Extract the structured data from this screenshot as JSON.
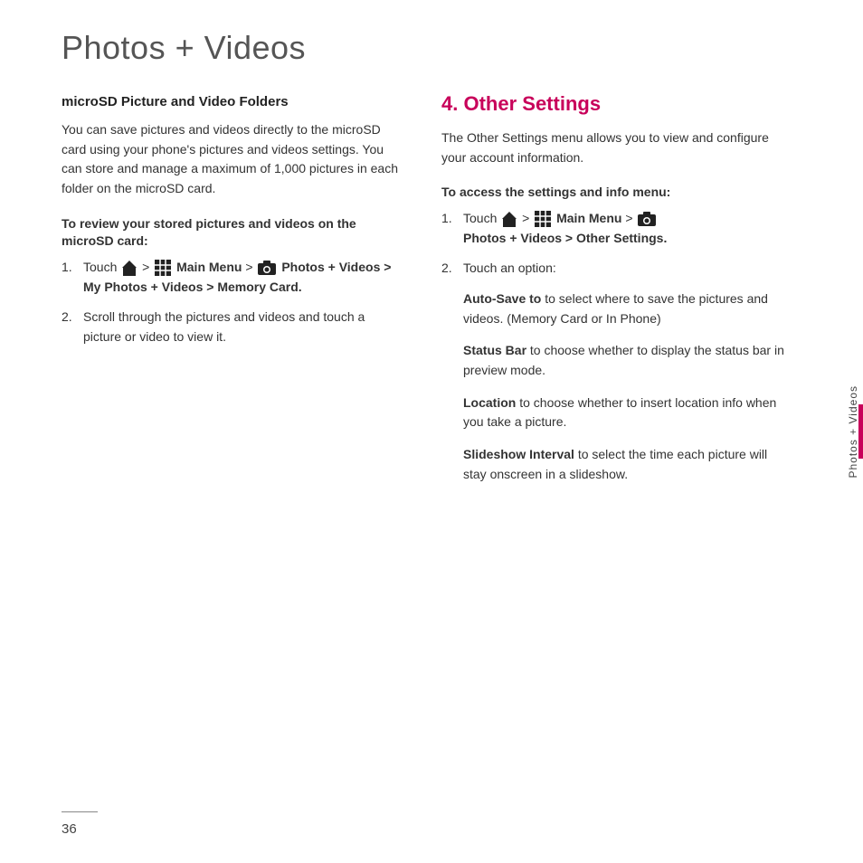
{
  "page": {
    "title": "Photos + Videos",
    "page_number": "36"
  },
  "sidebar": {
    "label": "Photos + Videos"
  },
  "left_column": {
    "heading": "microSD Picture and Video Folders",
    "body": "You can save pictures and videos directly to the microSD card using your phone's pictures and videos settings. You can store and manage a maximum of 1,000 pictures in each folder on the microSD card.",
    "subheading": "To review your stored pictures and videos on the microSD card:",
    "steps": [
      {
        "num": "1.",
        "text_before_icons": "Touch ",
        "text_between1": " > ",
        "text_between2": " Main Menu > ",
        "text_after_icons": "",
        "bold_text": "Photos + Videos > My Photos + Videos > Memory Card."
      },
      {
        "num": "2.",
        "text": "Scroll through the pictures and videos and touch a picture or video to view it."
      }
    ]
  },
  "right_column": {
    "section_number": "4.",
    "section_title": "Other Settings",
    "intro": "The Other Settings menu allows you to view and configure your account information.",
    "subheading": "To access the settings and info menu:",
    "steps": [
      {
        "num": "1.",
        "text_before_icons": "Touch ",
        "text_between1": " > ",
        "text_between2": " Main Menu > ",
        "bold_text": "Photos + Videos > Other Settings."
      },
      {
        "num": "2.",
        "text": "Touch an option:"
      }
    ],
    "options": [
      {
        "label": "Auto-Save to",
        "desc": " to select where to save the pictures and videos. (Memory Card or In Phone)"
      },
      {
        "label": "Status Bar",
        "desc": " to choose whether to display the status  bar in preview mode."
      },
      {
        "label": "Location",
        "desc": " to choose whether to insert location info when you take a picture."
      },
      {
        "label": "Slideshow Interval",
        "desc": " to select the time each picture will stay onscreen in a slideshow."
      }
    ]
  }
}
